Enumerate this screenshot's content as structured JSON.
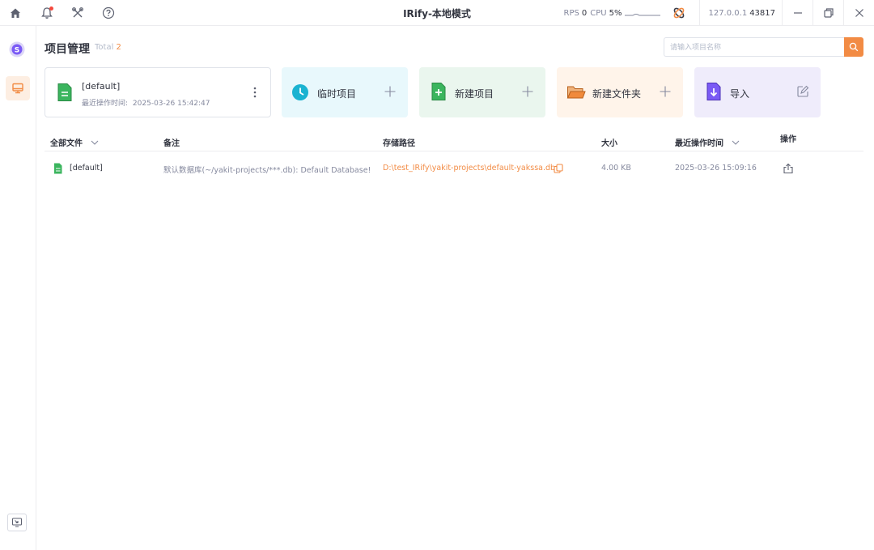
{
  "titlebar": {
    "title": "IRify-本地模式",
    "rps_label": "RPS",
    "rps_value": "0",
    "cpu_label": "CPU",
    "cpu_value": "5%",
    "host": "127.0.0.1",
    "port": "43817"
  },
  "page": {
    "title": "项目管理",
    "total_label": "Total",
    "total_value": "2"
  },
  "search": {
    "placeholder": "请输入项目名称"
  },
  "current_project": {
    "name": "[default]",
    "time_label": "最近操作时间:",
    "time_value": "2025-03-26 15:42:47"
  },
  "actions": [
    {
      "label": "临时项目",
      "bg": "#e8f8fc",
      "accent": "#1ab3d1",
      "icon": "clock-icon",
      "trail": "plus-icon"
    },
    {
      "label": "新建项目",
      "bg": "#eaf6ee",
      "accent": "#3bb55e",
      "icon": "add-file-icon",
      "trail": "plus-icon"
    },
    {
      "label": "新建文件夹",
      "bg": "#fff4ea",
      "accent": "#f08a3c",
      "icon": "folder-icon",
      "trail": "plus-icon"
    },
    {
      "label": "导入",
      "bg": "#efecfb",
      "accent": "#7a5af5",
      "icon": "import-file-icon",
      "trail": "edit-icon"
    }
  ],
  "table": {
    "columns": [
      "全部文件",
      "备注",
      "存储路径",
      "大小",
      "最近操作时间",
      "操作"
    ],
    "rows": [
      {
        "name": "[default]",
        "note": "默认数据库(~/yakit-projects/***.db): Default Database!",
        "path": "D:\\test_IRify\\yakit-projects\\default-yakssa.db",
        "size": "4.00 KB",
        "time": "2025-03-26 15:09:16"
      }
    ]
  },
  "colors": {
    "accent": "#f28b44",
    "green": "#3bb55e",
    "purple": "#7a5af5",
    "cyan": "#1ab3d1"
  }
}
